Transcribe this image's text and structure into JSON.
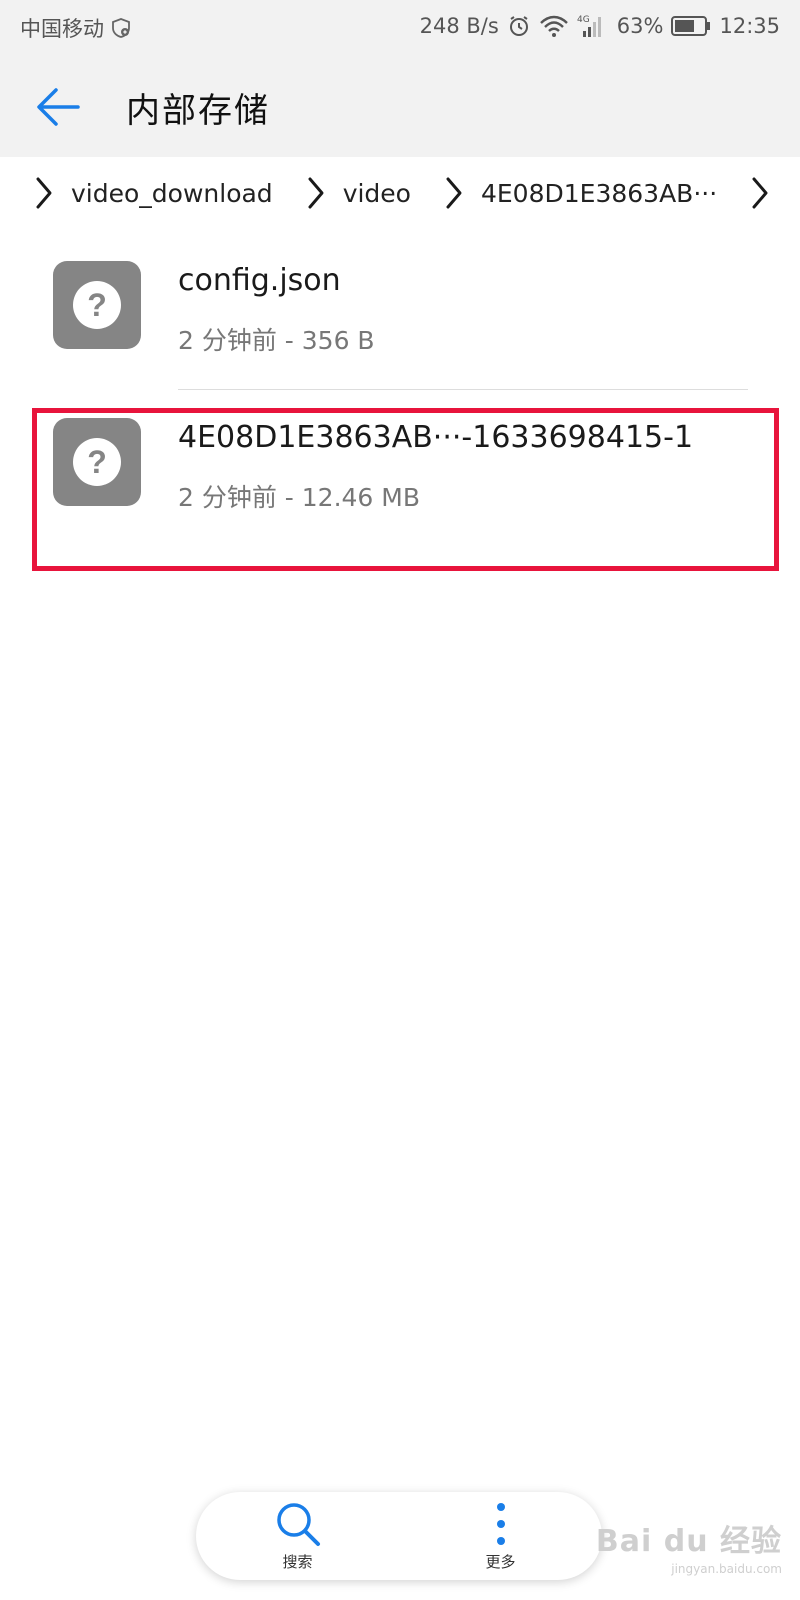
{
  "status_bar": {
    "carrier": "中国移动",
    "net_speed": "248 B/s",
    "network_type": "4G",
    "battery": "63%",
    "time": "12:35"
  },
  "header": {
    "title": "内部存储",
    "back_icon": "arrow-left-icon"
  },
  "breadcrumb": {
    "items": [
      "video_download",
      "video",
      "4E08D1E3863AB···"
    ]
  },
  "files": [
    {
      "name": "config.json",
      "meta": "2 分钟前 - 356 B",
      "icon": "unknown-file-icon"
    },
    {
      "name": "4E08D1E3863AB···-1633698415-1",
      "meta": "2 分钟前 - 12.46 MB",
      "icon": "unknown-file-icon"
    }
  ],
  "bottom_bar": {
    "search_label": "搜索",
    "more_label": "更多"
  },
  "watermark": {
    "main": "Bai du 经验",
    "sub": "jingyan.baidu.com"
  },
  "colors": {
    "accent": "#1a7ee8",
    "highlight": "#e8143c",
    "icon_bg": "#858585"
  }
}
